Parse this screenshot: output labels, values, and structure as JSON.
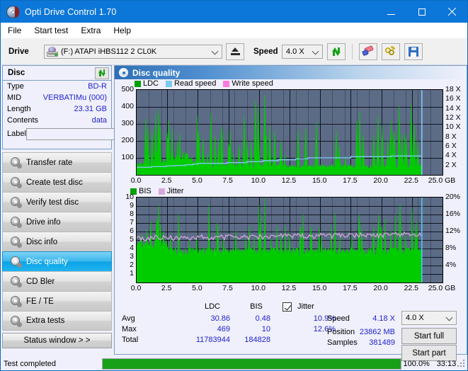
{
  "window": {
    "title": "Opti Drive Control 1.70",
    "icon": "disc-icon",
    "minimize": "minimize-icon",
    "maximize": "maximize-icon",
    "close": "close-icon",
    "titlebar_color": "#0c77d8"
  },
  "menu": {
    "items": [
      "File",
      "Start test",
      "Extra",
      "Help"
    ]
  },
  "toolbar": {
    "drive_label": "Drive",
    "drive_value": "(F:)  ATAPI iHBS112  2 CL0K",
    "eject": "eject-icon",
    "speed_label": "Speed",
    "speed_value": "4.0 X",
    "refresh": "refresh-icon",
    "erase": "erase-icon",
    "tools": "tools-icon",
    "save": "save-icon"
  },
  "disc_panel": {
    "title": "Disc",
    "refresh_icon": "refresh-icon",
    "rows": [
      {
        "key": "Type",
        "value": "BD-R"
      },
      {
        "key": "MID",
        "value": "VERBATIMu (000)"
      },
      {
        "key": "Length",
        "value": "23.31 GB"
      },
      {
        "key": "Contents",
        "value": "data"
      }
    ],
    "label_key": "Label",
    "label_value": "",
    "label_placeholder": "",
    "label_button_icon": "cd-icon"
  },
  "nav": {
    "items": [
      {
        "label": "Transfer rate",
        "active": false
      },
      {
        "label": "Create test disc",
        "active": false
      },
      {
        "label": "Verify test disc",
        "active": false
      },
      {
        "label": "Drive info",
        "active": false
      },
      {
        "label": "Disc info",
        "active": false
      },
      {
        "label": "Disc quality",
        "active": true
      },
      {
        "label": "CD Bler",
        "active": false
      },
      {
        "label": "FE / TE",
        "active": false
      },
      {
        "label": "Extra tests",
        "active": false
      }
    ],
    "status_window": "Status window > >"
  },
  "content": {
    "title": "Disc quality",
    "icon": "disc-quality-icon"
  },
  "chart_data": [
    {
      "type": "area",
      "title": "Disc quality - LDC",
      "xlabel": "GB",
      "ylabel": "",
      "xlim": [
        0,
        25
      ],
      "ylim": [
        0,
        500
      ],
      "xticks": [
        "0.0",
        "2.5",
        "5.0",
        "7.5",
        "10.0",
        "12.5",
        "15.0",
        "17.5",
        "20.0",
        "22.5",
        "25.0 GB"
      ],
      "yticks": [
        "100",
        "200",
        "300",
        "400",
        "500"
      ],
      "y2ticks": [
        "2 X",
        "4 X",
        "6 X",
        "8 X",
        "10 X",
        "12 X",
        "14 X",
        "16 X",
        "18 X"
      ],
      "y2lim": [
        0,
        18
      ],
      "grid": true,
      "legend": [
        {
          "name": "LDC",
          "color": "#00a000"
        },
        {
          "name": "Read speed",
          "color": "#7ec8ef"
        },
        {
          "name": "Write speed",
          "color": "#ff7ae0"
        }
      ],
      "data_end_gb": 23.31,
      "series": [
        {
          "name": "LDC",
          "color": "#00cc00",
          "baseline": [
            60,
            62,
            58,
            64,
            66,
            62,
            70,
            68,
            64,
            74,
            80,
            84,
            92,
            96,
            104,
            112,
            118,
            108,
            96,
            88,
            80,
            74,
            70,
            68,
            66,
            64,
            62,
            62,
            60,
            60,
            58,
            58,
            56,
            56,
            56,
            54,
            54,
            54,
            54,
            54,
            52,
            52,
            52,
            52,
            52,
            52,
            52,
            52,
            52,
            52,
            52,
            52,
            52,
            50,
            50,
            50,
            50,
            50,
            50,
            50,
            50,
            50,
            50,
            50,
            50,
            50,
            50,
            50,
            50,
            50,
            50,
            50,
            50,
            50,
            50,
            50,
            50,
            50,
            50,
            50,
            50,
            50,
            50,
            50,
            50,
            50,
            50,
            50,
            50,
            50,
            50,
            50,
            50,
            50,
            50,
            50,
            50,
            50,
            50,
            50
          ],
          "spikes": [
            {
              "gb": 0.75,
              "v": 330
            },
            {
              "gb": 0.95,
              "v": 282
            },
            {
              "gb": 1.25,
              "v": 268
            },
            {
              "gb": 1.55,
              "v": 360
            },
            {
              "gb": 1.8,
              "v": 382
            },
            {
              "gb": 1.9,
              "v": 290
            },
            {
              "gb": 2.6,
              "v": 322
            },
            {
              "gb": 2.9,
              "v": 274
            },
            {
              "gb": 3.35,
              "v": 200
            },
            {
              "gb": 4.95,
              "v": 350
            },
            {
              "gb": 5.1,
              "v": 252
            },
            {
              "gb": 5.45,
              "v": 216
            },
            {
              "gb": 5.8,
              "v": 122
            },
            {
              "gb": 6.1,
              "v": 368
            },
            {
              "gb": 6.45,
              "v": 236
            },
            {
              "gb": 6.7,
              "v": 214
            },
            {
              "gb": 6.95,
              "v": 284
            },
            {
              "gb": 7.5,
              "v": 182
            },
            {
              "gb": 7.65,
              "v": 262
            },
            {
              "gb": 7.95,
              "v": 124
            },
            {
              "gb": 8.4,
              "v": 176
            },
            {
              "gb": 8.8,
              "v": 345
            },
            {
              "gb": 9.05,
              "v": 202
            },
            {
              "gb": 9.35,
              "v": 200
            },
            {
              "gb": 9.75,
              "v": 440
            },
            {
              "gb": 9.95,
              "v": 400
            },
            {
              "gb": 10.45,
              "v": 470
            },
            {
              "gb": 10.6,
              "v": 230
            },
            {
              "gb": 10.9,
              "v": 288
            },
            {
              "gb": 11.3,
              "v": 253
            },
            {
              "gb": 11.8,
              "v": 200
            },
            {
              "gb": 12.1,
              "v": 118
            },
            {
              "gb": 13.2,
              "v": 262
            },
            {
              "gb": 13.85,
              "v": 278
            },
            {
              "gb": 14.7,
              "v": 312
            },
            {
              "gb": 16.3,
              "v": 262
            },
            {
              "gb": 16.55,
              "v": 174
            },
            {
              "gb": 17.05,
              "v": 112
            },
            {
              "gb": 18.0,
              "v": 318
            },
            {
              "gb": 18.25,
              "v": 372
            },
            {
              "gb": 18.5,
              "v": 236
            },
            {
              "gb": 19.4,
              "v": 235
            },
            {
              "gb": 19.75,
              "v": 348
            },
            {
              "gb": 20.1,
              "v": 292
            },
            {
              "gb": 20.55,
              "v": 210
            },
            {
              "gb": 20.8,
              "v": 318
            },
            {
              "gb": 21.05,
              "v": 262
            },
            {
              "gb": 21.45,
              "v": 405
            },
            {
              "gb": 21.7,
              "v": 238
            },
            {
              "gb": 22.05,
              "v": 220
            },
            {
              "gb": 22.45,
              "v": 420
            },
            {
              "gb": 22.7,
              "v": 302
            },
            {
              "gb": 22.95,
              "v": 200
            }
          ]
        },
        {
          "name": "Read speed",
          "color": "#7ec8ef",
          "steps": [
            {
              "gb": 0.0,
              "x": 1.6
            },
            {
              "gb": 1.2,
              "x": 1.75
            },
            {
              "gb": 2.4,
              "x": 1.9
            },
            {
              "gb": 3.2,
              "x": 2.0
            },
            {
              "gb": 4.0,
              "x": 2.15
            },
            {
              "gb": 4.6,
              "x": 2.3
            },
            {
              "gb": 5.0,
              "x": 2.45
            },
            {
              "gb": 7.4,
              "x": 2.6
            },
            {
              "gb": 9.0,
              "x": 2.8
            },
            {
              "gb": 10.3,
              "x": 3.0
            },
            {
              "gb": 11.6,
              "x": 3.2
            },
            {
              "gb": 13.0,
              "x": 3.4
            },
            {
              "gb": 14.0,
              "x": 3.6
            },
            {
              "gb": 17.5,
              "x": 3.85
            },
            {
              "gb": 20.8,
              "x": 4.0
            },
            {
              "gb": 23.3,
              "x": 4.18
            }
          ]
        }
      ]
    },
    {
      "type": "area",
      "title": "Disc quality - BIS / Jitter",
      "xlabel": "GB",
      "ylabel": "",
      "xlim": [
        0,
        25
      ],
      "ylim": [
        0,
        10
      ],
      "xticks": [
        "0.0",
        "2.5",
        "5.0",
        "7.5",
        "10.0",
        "12.5",
        "15.0",
        "17.5",
        "20.0",
        "22.5",
        "25.0 GB"
      ],
      "yticks": [
        "1",
        "2",
        "3",
        "4",
        "5",
        "6",
        "7",
        "8",
        "9",
        "10"
      ],
      "y2ticks": [
        "4%",
        "8%",
        "12%",
        "16%",
        "20%"
      ],
      "y2lim": [
        0,
        20
      ],
      "grid": true,
      "legend": [
        {
          "name": "BIS",
          "color": "#00a000"
        },
        {
          "name": "Jitter",
          "color": "#d8a8dd"
        }
      ],
      "data_end_gb": 23.31,
      "series": [
        {
          "name": "BIS",
          "color": "#00cc00",
          "baseline_before_gb": 2.55,
          "baseline_a": 5.0,
          "baseline_b": 4.0,
          "spikes": [
            {
              "gb": 0.35,
              "v": 5.6
            },
            {
              "gb": 0.8,
              "v": 6.2
            },
            {
              "gb": 1.15,
              "v": 7.2
            },
            {
              "gb": 1.35,
              "v": 4.2
            },
            {
              "gb": 1.6,
              "v": 7.0
            },
            {
              "gb": 1.8,
              "v": 9.1
            },
            {
              "gb": 1.95,
              "v": 6.8
            },
            {
              "gb": 2.2,
              "v": 6.0
            },
            {
              "gb": 2.75,
              "v": 5.3
            },
            {
              "gb": 3.4,
              "v": 8.0
            },
            {
              "gb": 4.3,
              "v": 5.0
            },
            {
              "gb": 4.9,
              "v": 5.5
            },
            {
              "gb": 5.9,
              "v": 9.2
            },
            {
              "gb": 6.6,
              "v": 7.0
            },
            {
              "gb": 7.1,
              "v": 5.2
            },
            {
              "gb": 8.1,
              "v": 6.1
            },
            {
              "gb": 8.9,
              "v": 5.2
            },
            {
              "gb": 9.6,
              "v": 5.4
            },
            {
              "gb": 10.0,
              "v": 9.1
            },
            {
              "gb": 10.15,
              "v": 8.0
            },
            {
              "gb": 10.5,
              "v": 10.0
            },
            {
              "gb": 11.0,
              "v": 5.2
            },
            {
              "gb": 11.8,
              "v": 5.6
            },
            {
              "gb": 12.5,
              "v": 6.0
            },
            {
              "gb": 13.4,
              "v": 6.3
            },
            {
              "gb": 13.6,
              "v": 8.0
            },
            {
              "gb": 14.3,
              "v": 5.6
            },
            {
              "gb": 15.1,
              "v": 5.4
            },
            {
              "gb": 16.2,
              "v": 8.2
            },
            {
              "gb": 16.6,
              "v": 5.5
            },
            {
              "gb": 17.6,
              "v": 5.5
            },
            {
              "gb": 18.2,
              "v": 8.0
            },
            {
              "gb": 18.4,
              "v": 6.4
            },
            {
              "gb": 19.3,
              "v": 5.2
            },
            {
              "gb": 19.8,
              "v": 8.0
            },
            {
              "gb": 20.3,
              "v": 7.6
            },
            {
              "gb": 20.8,
              "v": 6.1
            },
            {
              "gb": 21.1,
              "v": 8.0
            },
            {
              "gb": 21.5,
              "v": 9.2
            },
            {
              "gb": 22.0,
              "v": 5.6
            },
            {
              "gb": 22.5,
              "v": 8.8
            },
            {
              "gb": 22.9,
              "v": 7.2
            }
          ]
        },
        {
          "name": "Jitter",
          "color": "#d8a8dd",
          "avg_pct": 10.9,
          "max_pct": 12.6
        }
      ]
    }
  ],
  "stats": {
    "col_headers": [
      "LDC",
      "BIS"
    ],
    "jitter_header": "Jitter",
    "jitter_checked": true,
    "rows": [
      {
        "label": "Avg",
        "ldc": "30.86",
        "bis": "0.48",
        "jitter": "10.9%"
      },
      {
        "label": "Max",
        "ldc": "469",
        "bis": "10",
        "jitter": "12.6%"
      },
      {
        "label": "Total",
        "ldc": "11783944",
        "bis": "184828",
        "jitter": ""
      }
    ],
    "speed_label": "Speed",
    "speed_value": "4.18 X",
    "position_label": "Position",
    "position_value": "23862 MB",
    "samples_label": "Samples",
    "samples_value": "381489",
    "speed_select": "4.0 X",
    "start_full": "Start full",
    "start_part": "Start part"
  },
  "statusbar": {
    "text": "Test completed",
    "progress_pct": 100,
    "progress_label": "100.0%",
    "elapsed": "33:13"
  }
}
